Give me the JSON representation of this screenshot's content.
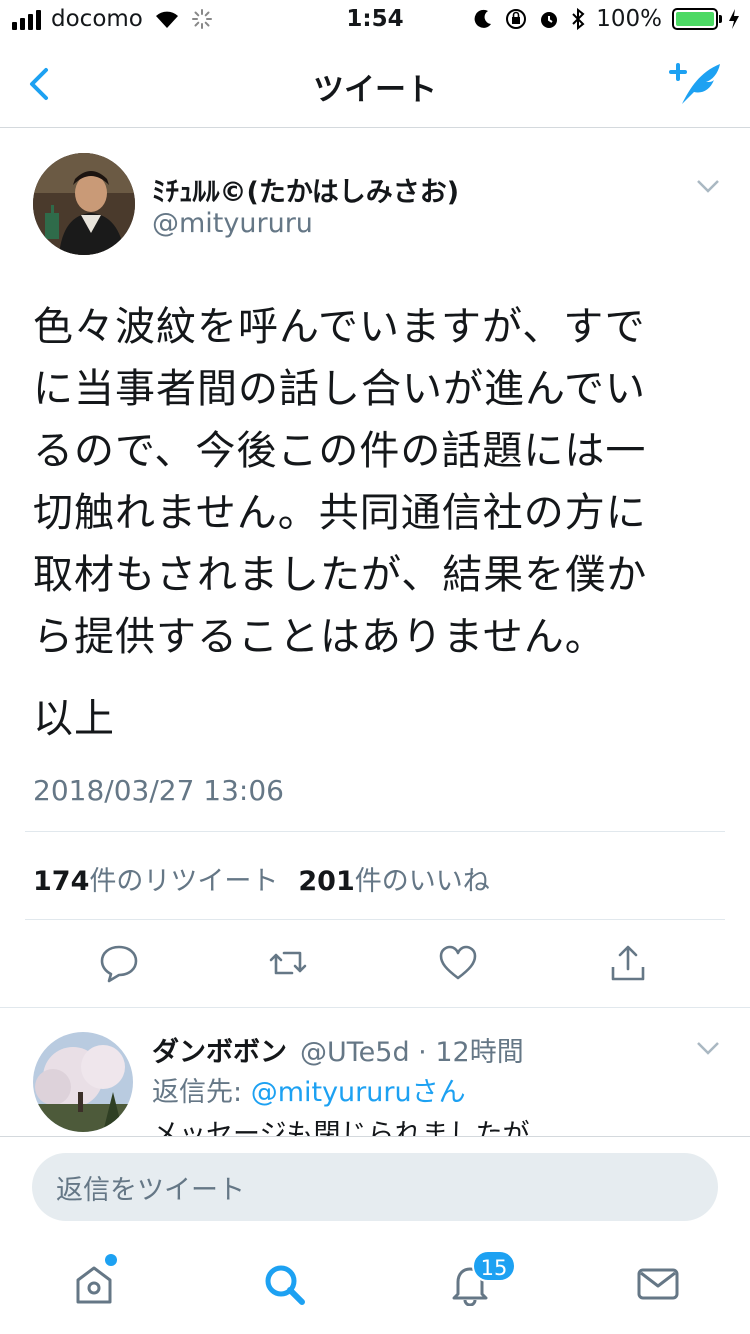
{
  "status_bar": {
    "carrier": "docomo",
    "time": "1:54",
    "battery_percent": "100%",
    "battery_level": 1.0
  },
  "nav": {
    "title": "ツイート",
    "back_icon": "chevron-left-icon",
    "compose_icon": "compose-tweet-icon"
  },
  "tweet": {
    "user_name": "ﾐﾁｭﾙﾙ©(たかはしみさお)",
    "handle": "@mityururu",
    "text_lines": [
      "色々波紋を呼んでいますが、すで\nに当事者間の話し合いが進んでい\nるので、今後この件の話題には一\n切触れません。共同通信社の方に\n取材もされましたが、結果を僕か\nら提供することはありません。",
      "以上"
    ],
    "timestamp": "2018/03/27 13:06",
    "retweet_count": "174",
    "retweet_label": "件のリツイート",
    "like_count": "201",
    "like_label": "件のいいね"
  },
  "reply": {
    "user_name": "ダンボボン",
    "meta": "@UTe5d · 12時間",
    "to_prefix": "返信先: ",
    "to_handle": "@mityururu",
    "to_suffix": "さん",
    "text": "メッセージも閉じられましたが"
  },
  "reply_bar": {
    "placeholder": "返信をツイート"
  },
  "tab_bar": {
    "notification_badge": "15"
  },
  "colors": {
    "accent": "#1da1f2",
    "secondary_text": "#657786",
    "primary_text": "#14171a",
    "divider": "#e1e8ed"
  }
}
